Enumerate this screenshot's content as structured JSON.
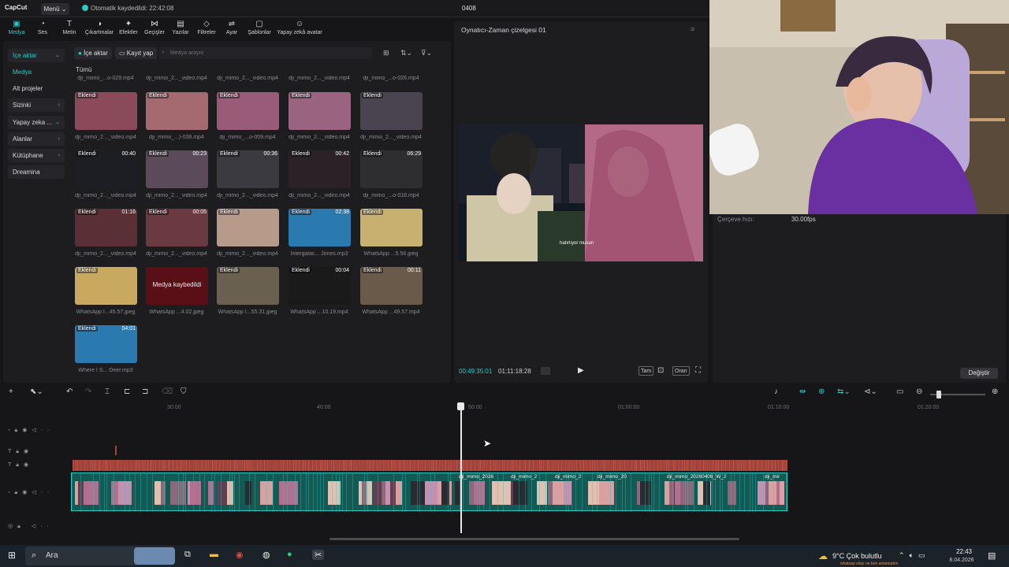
{
  "titlebar": {
    "logo": "CapCut",
    "menu": "Menü ⌄",
    "autosave": "Otomatik kaydedildi: 22:42:08",
    "project": "0408"
  },
  "toolbar": {
    "items": [
      {
        "icon": "media-icon",
        "glyph": "▣",
        "label": "Medya"
      },
      {
        "icon": "audio-icon",
        "glyph": "◔",
        "label": "Ses"
      },
      {
        "icon": "text-icon",
        "glyph": "T",
        "label": "Metin"
      },
      {
        "icon": "sticker-icon",
        "glyph": "◑",
        "label": "Çıkartmalar"
      },
      {
        "icon": "effects-icon",
        "glyph": "✦",
        "label": "Efektler"
      },
      {
        "icon": "transitions-icon",
        "glyph": "⋈",
        "label": "Geçişler"
      },
      {
        "icon": "captions-icon",
        "glyph": "▤",
        "label": "Yazılar"
      },
      {
        "icon": "filters-icon",
        "glyph": "◇",
        "label": "Filtreler"
      },
      {
        "icon": "adjust-icon",
        "glyph": "⇌",
        "label": "Ayar"
      },
      {
        "icon": "templates-icon",
        "glyph": "▢",
        "label": "Şablonlar"
      },
      {
        "icon": "ai-avatar-icon",
        "glyph": "☺",
        "label": "Yapay zekâ avatar"
      }
    ]
  },
  "sidebar": {
    "items": [
      {
        "label": "İçe aktar",
        "caret": "⌄"
      },
      {
        "label": "Medya",
        "caret": ""
      },
      {
        "label": "Alt projeler",
        "caret": ""
      },
      {
        "label": "Sizinki",
        "caret": "›"
      },
      {
        "label": "Yapay zeka ...",
        "caret": "⌄"
      },
      {
        "label": "Alanlar",
        "caret": "›"
      },
      {
        "label": "Kütüphane",
        "caret": "›"
      },
      {
        "label": "Dreamina",
        "caret": ""
      }
    ]
  },
  "media": {
    "import_label": "İçe aktar",
    "record_label": "Kayıt yap",
    "search_placeholder": "Medya arayın",
    "all_label": "Tümü",
    "top_names": [
      "dji_mimo_...o-029.mp4",
      "dji_mimo_2..._video.mp4",
      "dji_mimo_2..._video.mp4",
      "dji_mimo_2..._video.mp4",
      "dji_mimo_...o-026.mp4"
    ],
    "items": [
      {
        "tag": "Eklendi",
        "dur": "",
        "name": "dji_mimo_2..._video.mp4",
        "color": "#8a4a5a"
      },
      {
        "tag": "Eklendi",
        "dur": "",
        "name": "dji_mimo_...)-038.mp4",
        "color": "#a56a70"
      },
      {
        "tag": "Eklendi",
        "dur": "",
        "name": "dji_mimo_...o-009.mp4",
        "color": "#9a5b78"
      },
      {
        "tag": "Eklendi",
        "dur": "",
        "name": "dji_mimo_2..._video.mp4",
        "color": "#9a6480"
      },
      {
        "tag": "Eklendi",
        "dur": "",
        "name": "dji_mimo_2..._video.mp4",
        "color": "#4a4350"
      },
      {
        "tag": "Eklendi",
        "dur": "00:40",
        "name": "dji_mimo_2..._video.mp4",
        "color": "#1d1d24"
      },
      {
        "tag": "Eklendi",
        "dur": "00:23",
        "name": "dji_mimo_2..._video.mp4",
        "color": "#5a4a5a"
      },
      {
        "tag": "Eklendi",
        "dur": "00:36",
        "name": "dji_mimo_2..._video.mp4",
        "color": "#3a3a40"
      },
      {
        "tag": "Eklendi",
        "dur": "00:42",
        "name": "dji_mimo_2..._video.mp4",
        "color": "#2a2226"
      },
      {
        "tag": "Eklendi",
        "dur": "06:29",
        "name": "dji_mimo_...o-018.mp4",
        "color": "#2e2e30"
      },
      {
        "tag": "Eklendi",
        "dur": "01:16",
        "name": "dji_mimo_2..._video.mp4",
        "color": "#5a3036"
      },
      {
        "tag": "Eklendi",
        "dur": "00:05",
        "name": "dji_mimo_2..._video.mp4",
        "color": "#6a3a40"
      },
      {
        "tag": "Eklendi",
        "dur": "",
        "name": "dji_mimo_2..._video.mp4",
        "color": "#b89a8a"
      },
      {
        "tag": "Eklendi",
        "dur": "02:38",
        "name": "Intergalac... Jones.mp3",
        "color": "#2a7ab0"
      },
      {
        "tag": "Eklendi",
        "dur": "",
        "name": "WhatsApp ...5.56.jpeg",
        "color": "#c8b070"
      },
      {
        "tag": "Eklendi",
        "dur": "",
        "name": "WhatsApp I...45.57.jpeg",
        "color": "#c9a860"
      },
      {
        "tag": "",
        "dur": "",
        "name": "WhatsApp ...4.02.jpeg",
        "color": "#5a0e16",
        "lost": "Medya kaybedildi"
      },
      {
        "tag": "Eklendi",
        "dur": "",
        "name": "WhatsApp I...55.31.jpeg",
        "color": "#6a6050"
      },
      {
        "tag": "Eklendi",
        "dur": "00:04",
        "name": "WhatsApp ...10.19.mp4",
        "color": "#1a1a1a"
      },
      {
        "tag": "Eklendi",
        "dur": "00:11",
        "name": "WhatsApp ...49.57.mp4",
        "color": "#6a5a4a"
      },
      {
        "tag": "Eklendi",
        "dur": "04:01",
        "name": "Where I S... Deer.mp3",
        "color": "#2a7ab0"
      }
    ]
  },
  "player": {
    "title": "Oynatıcı-Zaman çizelgesi 01",
    "subtitle": "hatırlıyor musun",
    "current": "00:49:35:01",
    "total": "01:11:18:28",
    "full_label": "Tam",
    "ratio_label": "Oran"
  },
  "properties": {
    "fps_label": "Çerçeve hızı:",
    "fps_value": "30.00fps",
    "change_label": "Değiştir"
  },
  "timeline": {
    "ruler": [
      "30:00",
      "40:00",
      "50:00",
      "01:00:00",
      "01:10:00",
      "01:20:00"
    ],
    "clip_labels": [
      "dji_mimo_2026",
      "dji_mimo_2",
      "dji_mimo_2",
      "dji_mimo_20",
      "dji_mimo_20260408_W_2",
      "dji_mir"
    ]
  },
  "taskbar": {
    "search": "Ara",
    "weather": "9°C  Çok bulutlu",
    "weather_note": "whatsap olayı ne ben anlamadım",
    "time": "22:43",
    "date": "8.04.2026"
  }
}
